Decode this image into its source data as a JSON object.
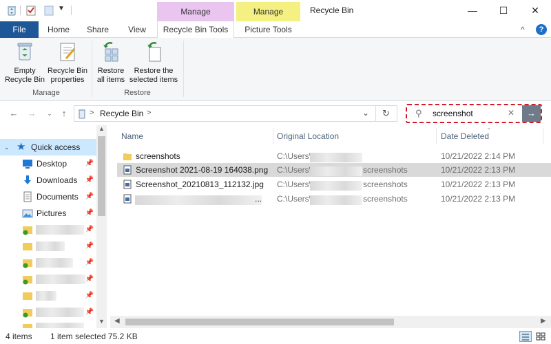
{
  "titlebar": {
    "title": "Recycle Bin",
    "context_tabs": [
      {
        "label": "Manage",
        "color": "#e9c5ef"
      },
      {
        "label": "Manage",
        "color": "#f4f081"
      }
    ],
    "minimize": "—",
    "maximize": "☐",
    "close": "✕"
  },
  "ribbon_tabs": {
    "file": "File",
    "home": "Home",
    "share": "Share",
    "view": "View",
    "recycle_bin_tools": "Recycle Bin Tools",
    "picture_tools": "Picture Tools"
  },
  "ribbon": {
    "empty_recycle_bin": [
      "Empty",
      "Recycle Bin"
    ],
    "recycle_bin_properties": [
      "Recycle Bin",
      "properties"
    ],
    "restore_all_items": [
      "Restore",
      "all items"
    ],
    "restore_selected_items": [
      "Restore the",
      "selected items"
    ],
    "group_manage": "Manage",
    "group_restore": "Restore"
  },
  "address": {
    "path": "Recycle Bin",
    "separator": ">"
  },
  "search": {
    "value": "screenshot"
  },
  "navpane": {
    "quick_access": "Quick access",
    "items": [
      {
        "label": "Desktop",
        "icon": "desktop-icon"
      },
      {
        "label": "Downloads",
        "icon": "downloads-icon"
      },
      {
        "label": "Documents",
        "icon": "documents-icon"
      },
      {
        "label": "Pictures",
        "icon": "pictures-icon"
      }
    ]
  },
  "columns": {
    "name": "Name",
    "original_location": "Original Location",
    "date_deleted": "Date Deleted"
  },
  "files": [
    {
      "name": "screenshots",
      "location": "C:\\Users\\",
      "location_suffix": "",
      "date": "10/21/2022 2:14 PM",
      "type": "folder",
      "selected": false
    },
    {
      "name": "Screenshot 2021-08-19 164038.png",
      "location": "C:\\Users\\",
      "location_suffix": "screenshots",
      "date": "10/21/2022 2:13 PM",
      "type": "image",
      "selected": true
    },
    {
      "name": "Screenshot_20210813_112132.jpg",
      "location": "C:\\Users\\",
      "location_suffix": "screenshots",
      "date": "10/21/2022 2:13 PM",
      "type": "image",
      "selected": false
    },
    {
      "name": "...",
      "location": "C:\\Users\\",
      "location_suffix": "screenshots",
      "date": "10/21/2022 2:13 PM",
      "type": "image",
      "selected": false
    }
  ],
  "status": {
    "items": "4 items",
    "selected": "1 item selected",
    "size": "75.2 KB"
  }
}
